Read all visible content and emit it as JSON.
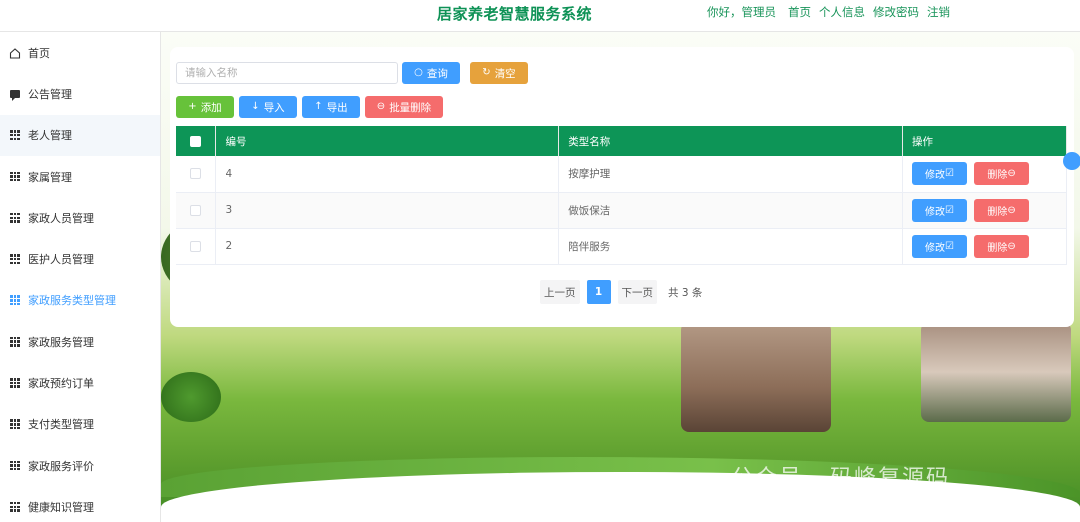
{
  "header": {
    "title": "居家养老智慧服务系统",
    "greeting": "你好，管理员",
    "links": [
      "首页",
      "个人信息",
      "修改密码",
      "注销"
    ]
  },
  "sidebar": {
    "items": [
      {
        "label": "首页",
        "icon": "home-icon"
      },
      {
        "label": "公告管理",
        "icon": "comment-icon"
      },
      {
        "label": "老人管理",
        "icon": "grid-icon"
      },
      {
        "label": "家属管理",
        "icon": "grid-icon"
      },
      {
        "label": "家政人员管理",
        "icon": "grid-icon"
      },
      {
        "label": "医护人员管理",
        "icon": "grid-icon"
      },
      {
        "label": "家政服务类型管理",
        "icon": "grid-icon"
      },
      {
        "label": "家政服务管理",
        "icon": "grid-icon"
      },
      {
        "label": "家政预约订单",
        "icon": "grid-icon"
      },
      {
        "label": "支付类型管理",
        "icon": "grid-icon"
      },
      {
        "label": "家政服务评价",
        "icon": "grid-icon"
      },
      {
        "label": "健康知识管理",
        "icon": "grid-icon"
      }
    ],
    "active_index": 6,
    "hover_index": 2
  },
  "search": {
    "placeholder": "请输入名称",
    "value": "",
    "query_label": "查询",
    "clear_label": "清空"
  },
  "toolbar": {
    "add_label": "添加",
    "import_label": "导入",
    "export_label": "导出",
    "batch_delete_label": "批量删除"
  },
  "table": {
    "columns": [
      "编号",
      "类型名称",
      "操作"
    ],
    "rows": [
      {
        "id": "4",
        "name": "按摩护理"
      },
      {
        "id": "3",
        "name": "做饭保洁"
      },
      {
        "id": "2",
        "name": "陪伴服务"
      }
    ],
    "edit_label": "修改",
    "delete_label": "删除"
  },
  "pagination": {
    "prev_label": "上一页",
    "current_page": "1",
    "next_label": "下一页",
    "total_label": "共 3 条"
  },
  "watermark": "公众号 · 码峰复源码",
  "colors": {
    "brand_green": "#0d9557",
    "primary_blue": "#409eff",
    "warning_orange": "#e6a23c",
    "success_green": "#67c23a",
    "danger_red": "#f56c6c"
  }
}
